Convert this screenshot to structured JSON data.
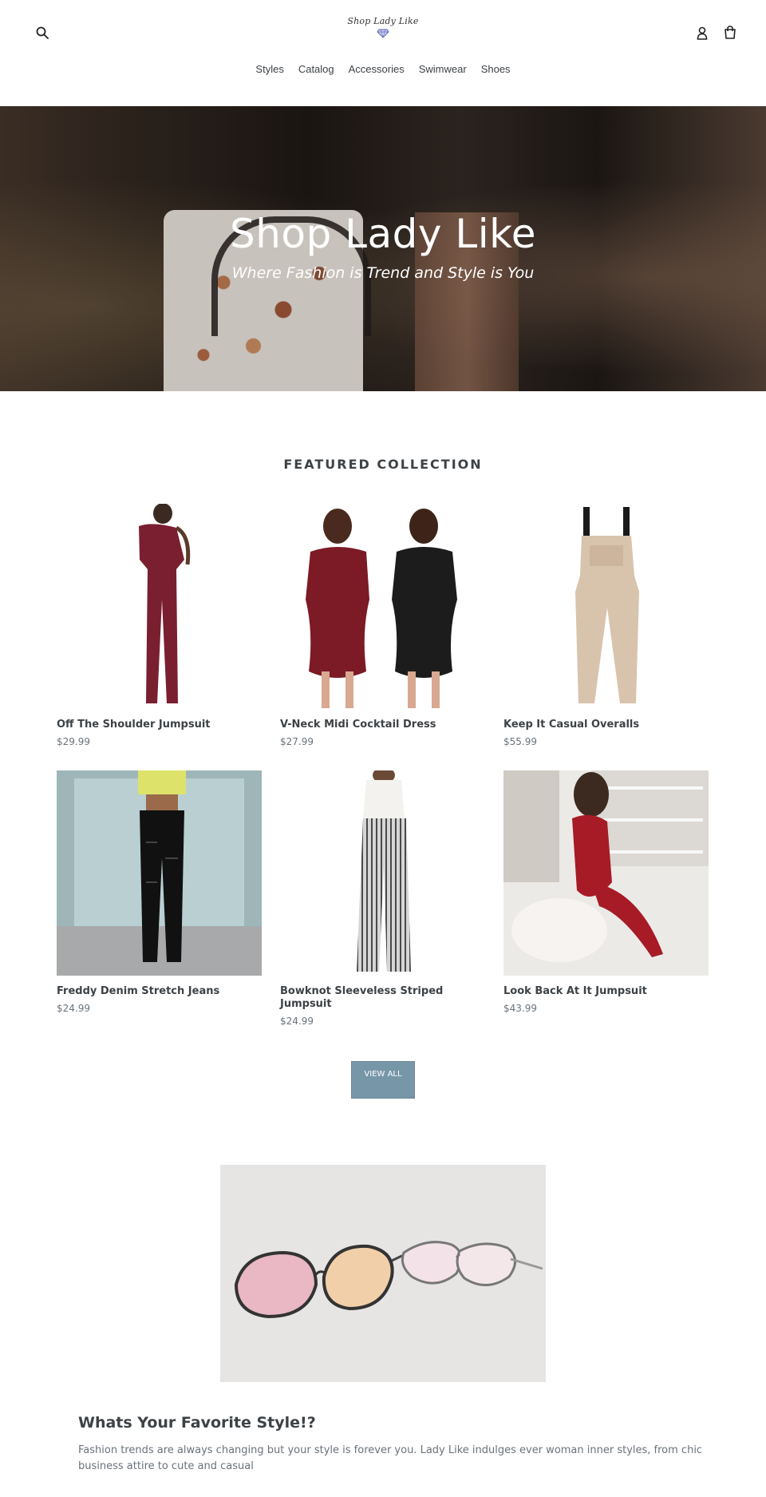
{
  "header": {
    "logo_text": "Shop Lady Like",
    "nav": [
      "Styles",
      "Catalog",
      "Accessories",
      "Swimwear",
      "Shoes"
    ]
  },
  "hero": {
    "title": "Shop Lady Like",
    "subtitle": "Where Fashion is Trend and Style is You"
  },
  "featured": {
    "title": "FEATURED COLLECTION",
    "products": [
      {
        "name": "Off The Shoulder Jumpsuit",
        "price": "$29.99"
      },
      {
        "name": "V-Neck Midi Cocktail Dress",
        "price": "$27.99"
      },
      {
        "name": "Keep It Casual Overalls",
        "price": "$55.99"
      },
      {
        "name": "Freddy Denim Stretch Jeans",
        "price": "$24.99"
      },
      {
        "name": "Bowknot Sleeveless Striped Jumpsuit",
        "price": "$24.99"
      },
      {
        "name": "Look Back At It Jumpsuit",
        "price": "$43.99"
      }
    ],
    "view_all": "VIEW ALL"
  },
  "blurb": {
    "title": "Whats Your Favorite Style!?",
    "text": "Fashion trends are always changing but your style is forever you. Lady Like indulges ever woman inner styles, from chic business attire to cute and casual"
  },
  "colors": {
    "button": "#7796a8",
    "text": "#3d4246",
    "muted": "#69727b"
  },
  "icons": [
    "search-icon",
    "account-icon",
    "cart-icon",
    "diamond-icon"
  ]
}
